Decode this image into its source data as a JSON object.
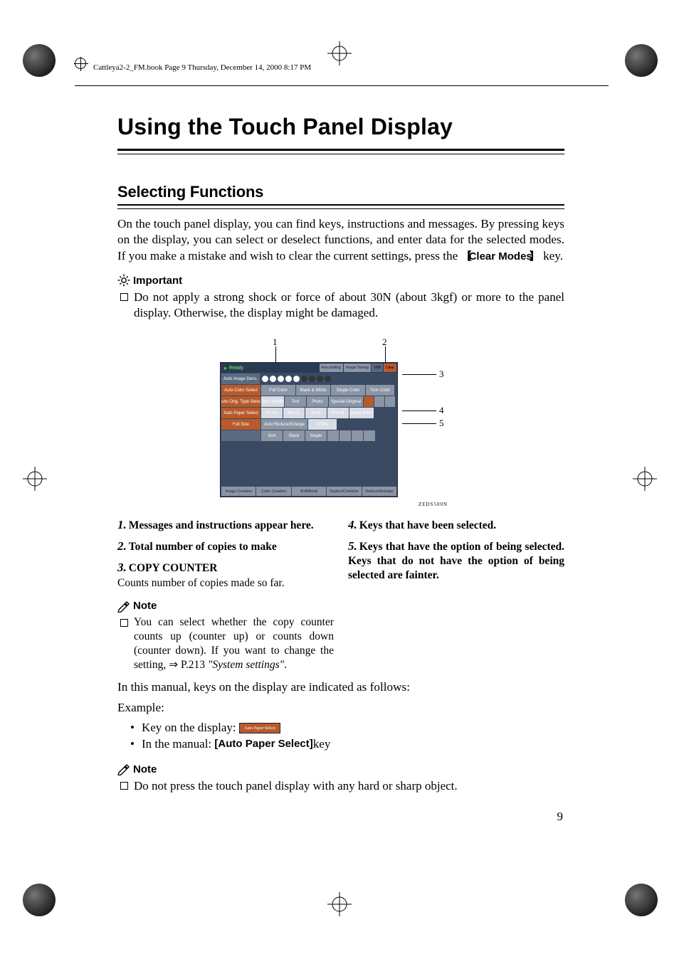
{
  "header": {
    "text": "Cattleya2-2_FM.book  Page 9  Thursday, December 14, 2000  8:17 PM"
  },
  "title": "Using the Touch Panel Display",
  "section": "Selecting Functions",
  "intro": "On the touch panel display, you can find keys, instructions and messages. By pressing keys on the display, you can select or deselect functions, and enter data for the selected modes. If you make a mistake and wish to clear the current settings, press the ",
  "intro_key": "Clear Modes",
  "intro_tail": " key.",
  "important_head": "Important",
  "important_body": "Do not apply a strong shock or force of about 30N (about 3kgf) or more to the panel display. Otherwise, the display might be damaged.",
  "shot": {
    "top1": "1",
    "top2": "2",
    "r3": "3",
    "r4": "4",
    "r5": "5",
    "ready": "Ready",
    "top_right": [
      "Area Editing",
      "Image Overlay",
      "1/99",
      "Clear"
    ],
    "density_label": "Auto Image Dens.",
    "row_color": {
      "label": "Auto Color Select",
      "opts": [
        "Full Color",
        "Black & White",
        "Single Color",
        "Twin Color"
      ]
    },
    "row_orig": {
      "label": "Auto Orig. Type Select",
      "opts": [
        "Text / Photo",
        "Text",
        "Photo",
        "Special Original"
      ]
    },
    "row_paper": {
      "label": "Auto Paper Select",
      "opts": [
        "8½×11",
        "8½×11",
        "8×13",
        "8½×11",
        "Bypass 8½×11"
      ]
    },
    "row_size": [
      "Full Size",
      "Auto Reduce/Enlarge",
      "100%"
    ],
    "row_sort": {
      "label": "",
      "opts": [
        "Sort",
        "Stack",
        "Staple"
      ]
    },
    "footer": [
      "Image Creation",
      "Color Creation",
      "Shift/Book",
      "Duplex/Combine",
      "Reduce/Enlarge"
    ],
    "code": "ZEDS500N"
  },
  "items": [
    {
      "n": "1.",
      "text": "Messages and instructions appear here."
    },
    {
      "n": "2.",
      "text": "Total number of copies to make"
    },
    {
      "n": "3.",
      "text": "COPY COUNTER"
    },
    {
      "n": "4.",
      "text": "Keys that have been selected."
    },
    {
      "n": "5.",
      "text": "Keys that have the option of being selected. Keys that do not have the option of being selected are fainter."
    }
  ],
  "copy_counter_sub": "Counts number of copies made so far.",
  "note_head": "Note",
  "note_body": "You can select whether the copy counter counts up (counter up) or counts down (counter down). If you want to change the setting, ⇒ P.213 ",
  "note_ref": "\"System settings\"",
  "note_tail": ".",
  "post1": "In this manual, keys on the display are indicated as follows:",
  "post2": "Example:",
  "bullet1_pre": "Key on the display: ",
  "bullet1_key": "Auto Paper Select",
  "bullet2_pre": "In the manual: ",
  "bullet2_key": "[Auto Paper Select]",
  "bullet2_post": " key",
  "note2": "Do not press the touch panel display with any hard or sharp object.",
  "page_number": "9"
}
